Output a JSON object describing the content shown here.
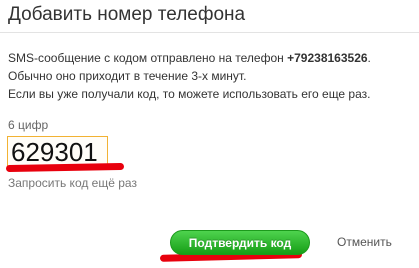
{
  "dialog": {
    "title": "Добавить номер телефона",
    "description": {
      "line1_prefix": "SMS-сообщение с кодом отправлено на телефон ",
      "phone": "+79238163526",
      "line1_suffix": ".",
      "line2": "Обычно оно приходит в течение 3-х минут.",
      "line3": "Если вы уже получали код, то можете использовать его еще раз."
    },
    "code_field": {
      "label": "6 цифр",
      "value": "629301"
    },
    "resend_link": "Запросить код ещё раз",
    "confirm_button": "Подтвердить код",
    "cancel_link": "Отменить"
  },
  "colors": {
    "accent_green": "#1aa81a",
    "input_border": "#f2b233",
    "annotation_red": "#e8000d"
  }
}
